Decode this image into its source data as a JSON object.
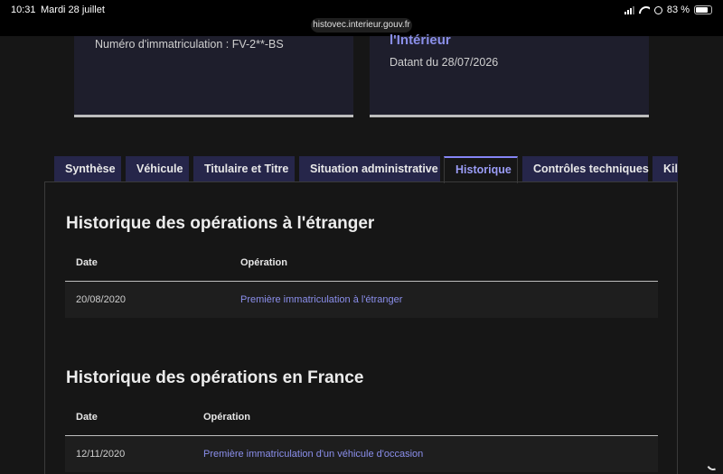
{
  "status_bar": {
    "time": "10:31",
    "date": "Mardi 28 juillet",
    "url": "histovec.interieur.gouv.fr",
    "battery": "83 %"
  },
  "cards": {
    "left_text": "Numéro d'immatriculation : FV-2**-BS",
    "right_link": "l'Intérieur",
    "right_text": "Datant du 28/07/2026"
  },
  "tabs": [
    {
      "label": "Synthèse"
    },
    {
      "label": "Véhicule"
    },
    {
      "label": "Titulaire et Titre"
    },
    {
      "label": "Situation administrative"
    },
    {
      "label": "Historique",
      "active": true
    },
    {
      "label": "Contrôles techniques"
    },
    {
      "label": "Kil"
    }
  ],
  "foreign": {
    "title": "Historique des opérations à l'étranger",
    "col_date": "Date",
    "col_op": "Opération",
    "rows": [
      {
        "date": "20/08/2020",
        "operation": "Première immatriculation à l'étranger"
      }
    ]
  },
  "france": {
    "title": "Historique des opérations en France",
    "col_date": "Date",
    "col_op": "Opération",
    "rows": [
      {
        "date": "12/11/2020",
        "operation": "Première immatriculation d'un véhicule d'occasion"
      }
    ]
  },
  "colors": {
    "accent": "#8585f6",
    "tab_bg": "#26264a",
    "page_bg": "#161616"
  }
}
